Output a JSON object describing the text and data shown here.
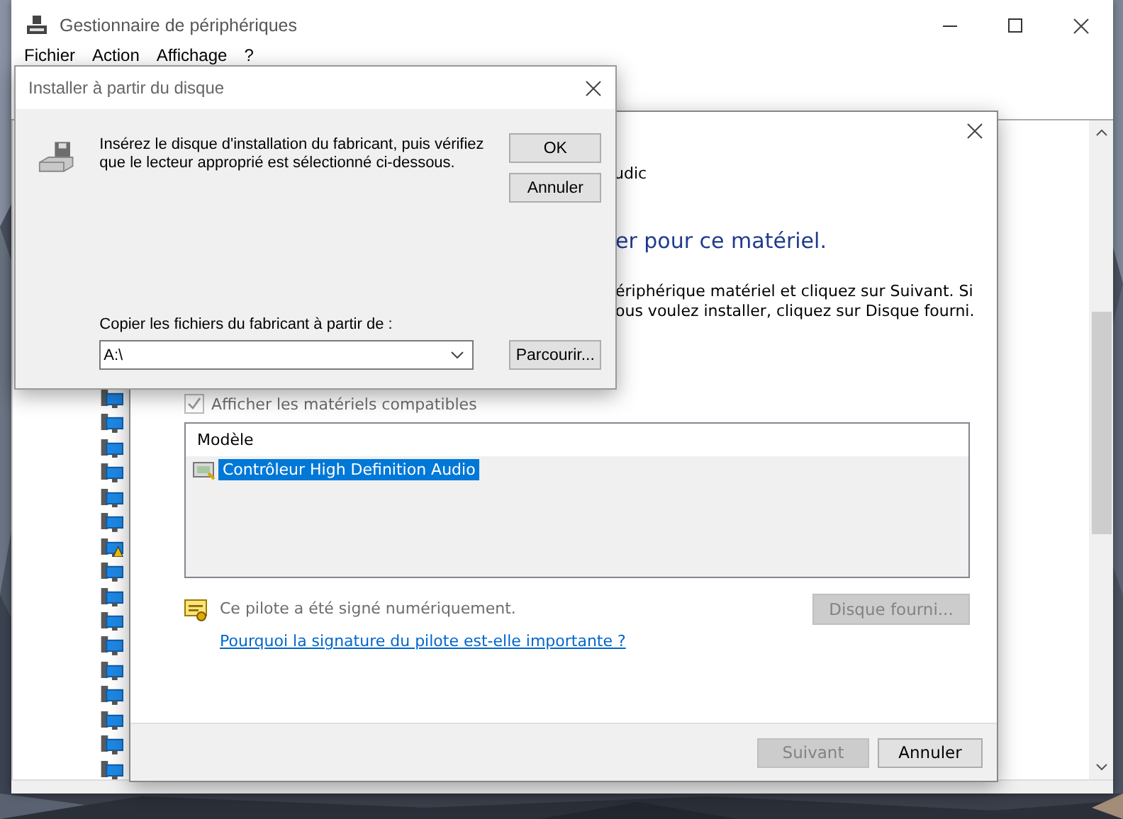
{
  "main_window": {
    "title": "Gestionnaire de périphériques",
    "menu": [
      "Fichier",
      "Action",
      "Affichage",
      "?"
    ],
    "devices": [
      {
        "warning": false
      },
      {
        "warning": false
      },
      {
        "warning": false
      },
      {
        "warning": false
      },
      {
        "warning": false
      },
      {
        "warning": false
      },
      {
        "warning": true
      },
      {
        "warning": false
      },
      {
        "warning": false
      },
      {
        "warning": false
      },
      {
        "warning": false
      },
      {
        "warning": false
      },
      {
        "warning": false
      },
      {
        "warning": false
      },
      {
        "warning": false
      },
      {
        "warning": false
      }
    ]
  },
  "wizard": {
    "device_name": "udic",
    "heading": "er pour ce matériel.",
    "instructions": [
      "ériphérique matériel et cliquez sur Suivant. Si",
      "ous voulez installer, cliquez sur Disque fourni."
    ],
    "show_compatible": {
      "label": "Afficher les matériels compatibles",
      "checked": true,
      "disabled": true
    },
    "list": {
      "column": "Modèle",
      "rows": [
        {
          "label": "Contrôleur High Definition Audio",
          "selected": true
        }
      ]
    },
    "signature_text": "Ce pilote a été signé numériquement.",
    "have_disk_button": {
      "label": "Disque fourni...",
      "disabled": true
    },
    "signature_link": "Pourquoi la signature du pilote est-elle importante ?",
    "buttons": [
      {
        "label": "Suivant",
        "disabled": true
      },
      {
        "label": "Annuler",
        "disabled": false
      }
    ]
  },
  "disk_dialog": {
    "title": "Installer à partir du disque",
    "message_lines": [
      "Insérez le disque d'installation du fabricant, puis vérifiez",
      "que le lecteur approprié est sélectionné ci-dessous."
    ],
    "buttons": [
      "OK",
      "Annuler"
    ],
    "copy_label": "Copier les fichiers du fabricant à partir de :",
    "path": "A:\\",
    "browse_button": "Parcourir..."
  }
}
